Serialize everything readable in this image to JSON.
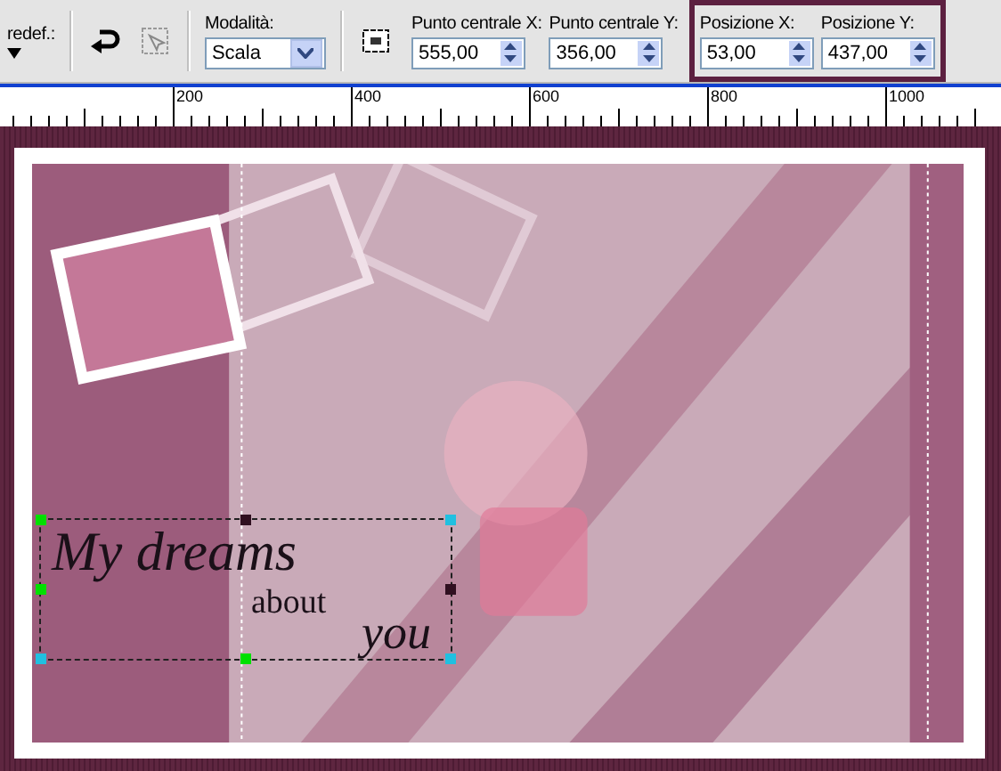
{
  "toolbar": {
    "preset": {
      "label": "redef.:"
    },
    "mode": {
      "label": "Modalità:",
      "value": "Scala"
    },
    "groups": [
      {
        "highlighted": false,
        "fields": [
          {
            "label": "Punto centrale X:",
            "value": "555,00"
          },
          {
            "label": "Punto centrale Y:",
            "value": "356,00"
          }
        ]
      },
      {
        "highlighted": true,
        "fields": [
          {
            "label": "Posizione X:",
            "value": "53,00"
          },
          {
            "label": "Posizione Y:",
            "value": "437,00"
          }
        ]
      }
    ]
  },
  "ruler": {
    "labels": [
      "200",
      "400",
      "600",
      "800",
      "1000"
    ]
  },
  "canvas": {
    "text_layer": {
      "selected": true,
      "lines": [
        "My dreams",
        "about",
        "you"
      ]
    }
  }
}
